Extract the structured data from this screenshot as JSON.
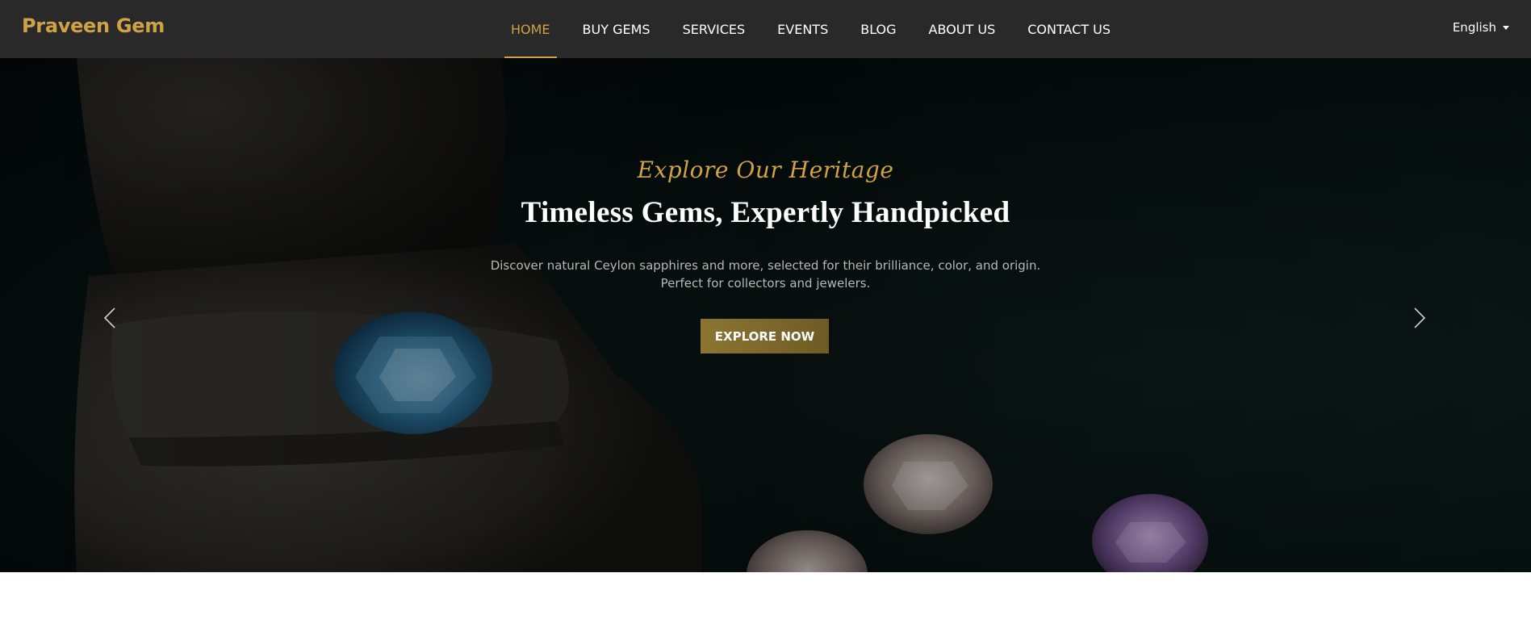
{
  "brand": {
    "name": "Praveen Gem",
    "color": "#cfa246"
  },
  "nav": {
    "items": [
      {
        "label": "HOME",
        "active": true
      },
      {
        "label": "BUY GEMS",
        "active": false
      },
      {
        "label": "SERVICES",
        "active": false
      },
      {
        "label": "EVENTS",
        "active": false
      },
      {
        "label": "BLOG",
        "active": false
      },
      {
        "label": "ABOUT US",
        "active": false
      },
      {
        "label": "CONTACT US",
        "active": false
      }
    ]
  },
  "language": {
    "selected": "English",
    "icon": "chevron-down-icon"
  },
  "hero": {
    "kicker": "Explore Our Heritage",
    "headline": "Timeless Gems, Expertly Handpicked",
    "description_line1": "Discover natural Ceylon sapphires and more, selected for their brilliance, color, and origin.",
    "description_line2": "Perfect for collectors and jewelers.",
    "cta_label": "EXPLORE NOW",
    "prev_icon": "chevron-left-icon",
    "next_icon": "chevron-right-icon",
    "image": "blue sapphire in dark velvet ring box with loose gems"
  },
  "colors": {
    "accent": "#cfa246",
    "navbar_bg": "#292929",
    "cta_bg": "#8c7533"
  }
}
